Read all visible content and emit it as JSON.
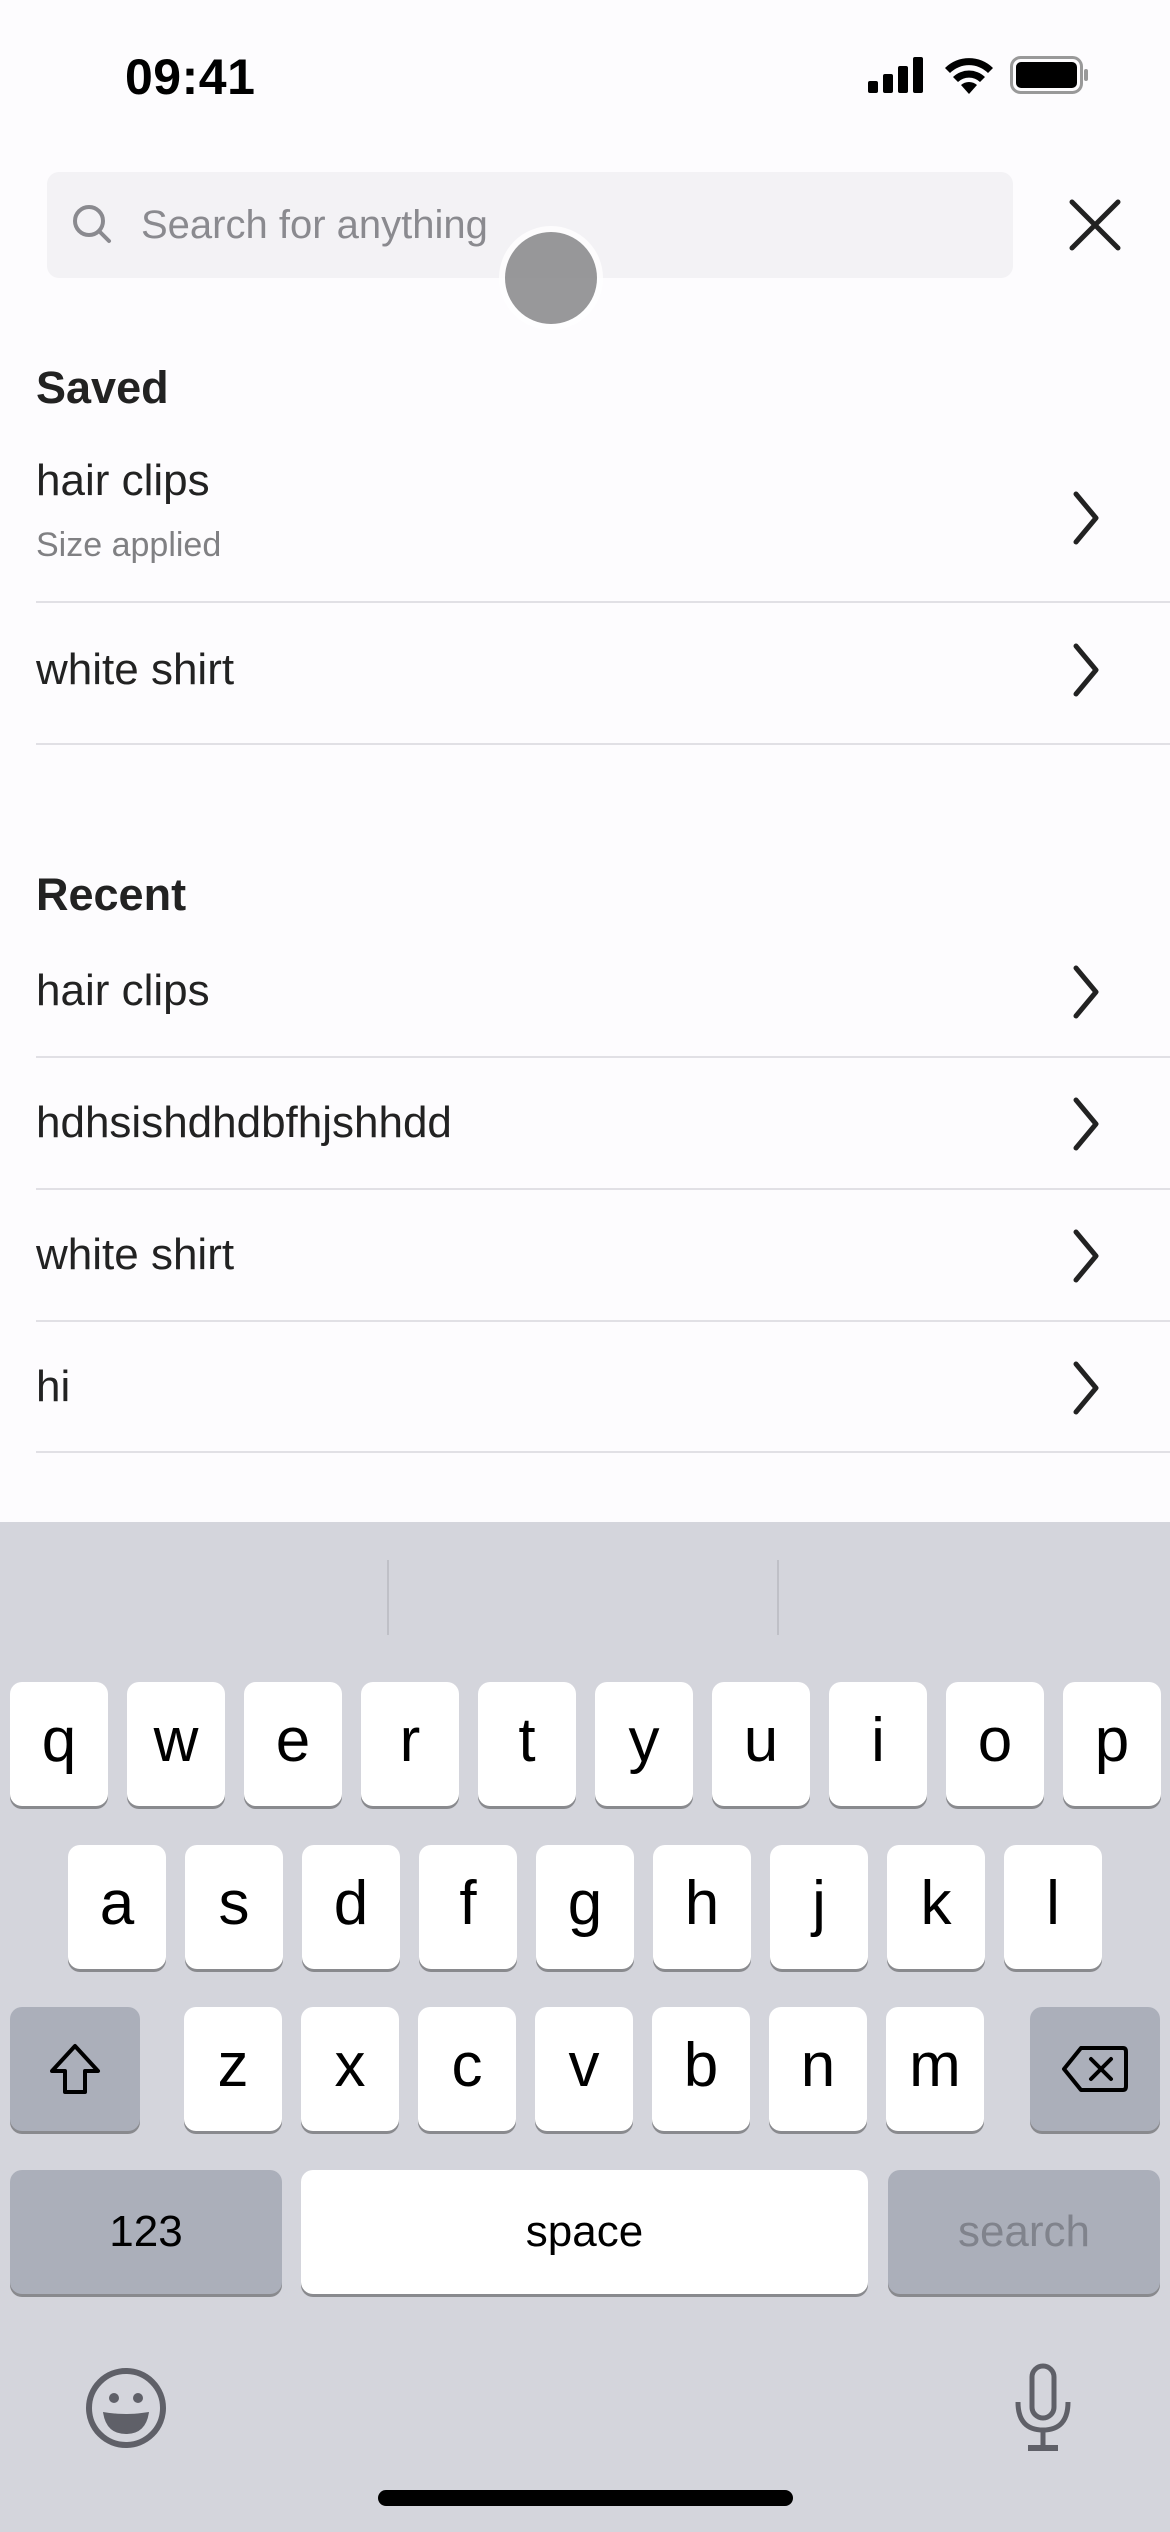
{
  "status_bar": {
    "time": "09:41",
    "icons": [
      "cellular-signal-icon",
      "wifi-icon",
      "battery-icon"
    ]
  },
  "search": {
    "placeholder": "Search for anything",
    "value": "",
    "icon": "search-icon",
    "close_icon": "close-icon"
  },
  "saved": {
    "heading": "Saved",
    "items": [
      {
        "label": "hair clips",
        "sub": "Size applied"
      },
      {
        "label": "white shirt",
        "sub": ""
      }
    ]
  },
  "recent": {
    "heading": "Recent",
    "items": [
      {
        "label": "hair clips"
      },
      {
        "label": "hdhsishdhdbfhjshhdd"
      },
      {
        "label": "white shirt"
      },
      {
        "label": "hi"
      }
    ]
  },
  "keyboard": {
    "row1": [
      "q",
      "w",
      "e",
      "r",
      "t",
      "y",
      "u",
      "i",
      "o",
      "p"
    ],
    "row2": [
      "a",
      "s",
      "d",
      "f",
      "g",
      "h",
      "j",
      "k",
      "l"
    ],
    "row3": [
      "z",
      "x",
      "c",
      "v",
      "b",
      "n",
      "m"
    ],
    "numbers_label": "123",
    "space_label": "space",
    "return_label": "search",
    "shift_icon": "shift-icon",
    "delete_icon": "delete-icon",
    "emoji_icon": "emoji-icon",
    "mic_icon": "microphone-icon"
  }
}
